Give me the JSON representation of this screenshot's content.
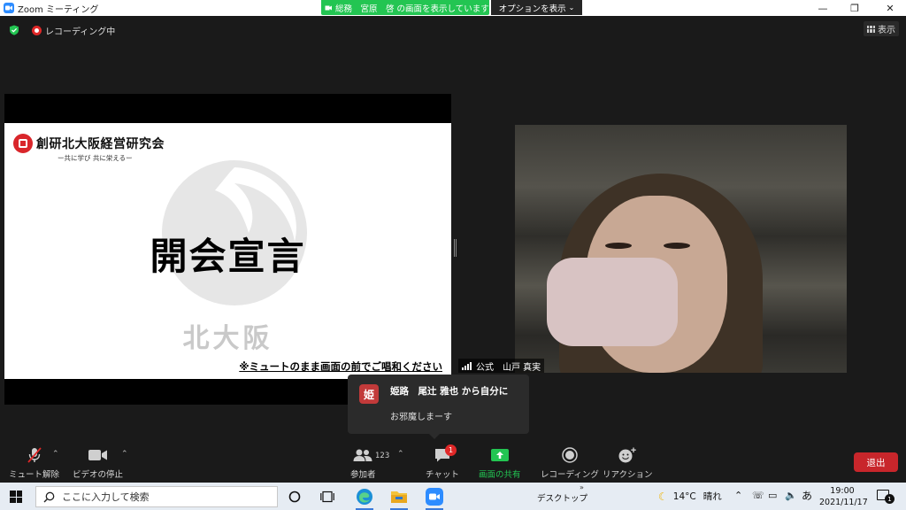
{
  "window": {
    "title": "Zoom ミーティング",
    "controls": [
      "minimize",
      "restore",
      "close"
    ]
  },
  "share_banner": {
    "text": "総務　宮原　啓 の画面を表示しています",
    "options_label": "オプションを表示"
  },
  "status": {
    "recording_label": "レコーディング中",
    "view_label": "表示"
  },
  "slide": {
    "org_name": "創研北大阪経営研究会",
    "org_tagline": "ー共に学び 共に栄えるー",
    "title": "開会宣言",
    "watermark": "北大阪",
    "note": "※ミュートのまま画面の前でご唱和ください"
  },
  "participant": {
    "name": "公式　山戸 真実"
  },
  "chat_popup": {
    "avatar_char": "姫",
    "from": "姫路　尾辻 雅也 から自分に",
    "message": "お邪魔しまーす"
  },
  "toolbar": {
    "unmute_label": "ミュート解除",
    "stop_video_label": "ビデオの停止",
    "participants_label": "参加者",
    "participants_count": "123",
    "chat_label": "チャット",
    "chat_badge": "1",
    "share_label": "画面の共有",
    "record_label": "レコーディング",
    "reactions_label": "リアクション",
    "leave_label": "退出"
  },
  "taskbar": {
    "search_placeholder": "ここに入力して検索",
    "desktop_label": "デスクトップ",
    "temperature": "14°C",
    "weather": "晴れ",
    "ime": "あ",
    "time": "19:00",
    "date": "2021/11/17",
    "notification_count": "1"
  },
  "colors": {
    "zoom_blue": "#2d8cff",
    "share_green": "#23c552",
    "leave_red": "#c8262b",
    "record_red": "#e02828"
  }
}
